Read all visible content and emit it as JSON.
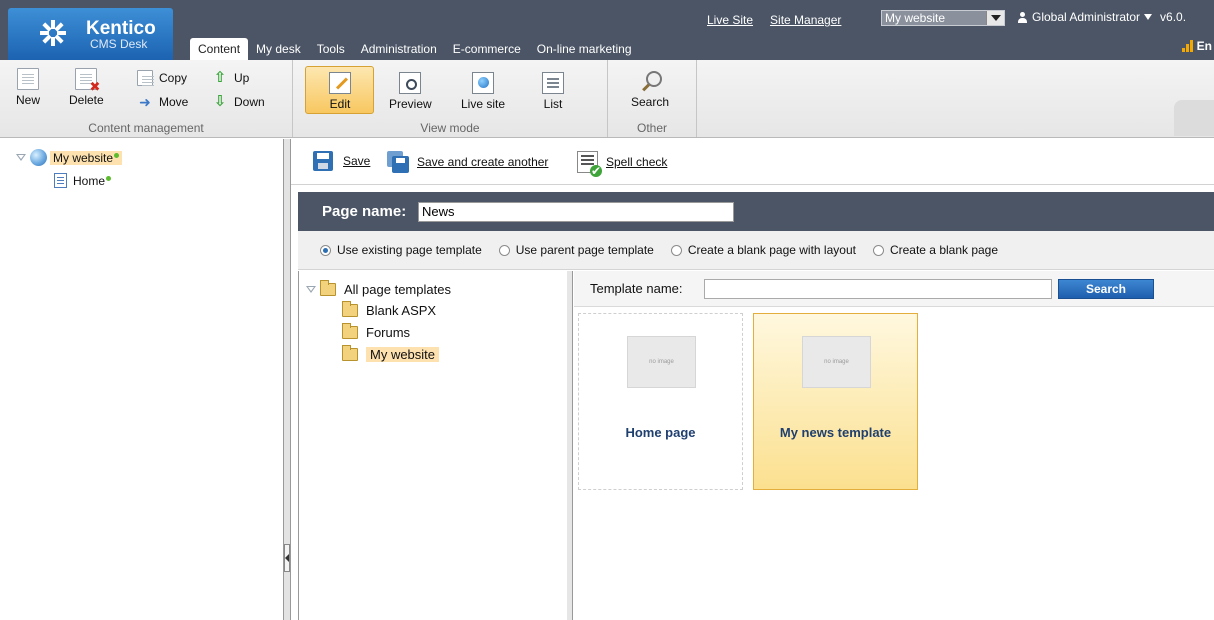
{
  "brand": {
    "name": "Kentico",
    "product": "CMS Desk",
    "accent": "#1c63b2"
  },
  "header": {
    "links": [
      "Live Site",
      "Site Manager"
    ],
    "site_select": "My website",
    "user": "Global Administrator",
    "version": "v6.0.",
    "lang": "En",
    "tabs": [
      "Content",
      "My desk",
      "Tools",
      "Administration",
      "E-commerce",
      "On-line marketing"
    ],
    "active_tab": "Content"
  },
  "ribbon": {
    "content_management": {
      "label": "Content management",
      "new": "New",
      "delete": "Delete",
      "copy": "Copy",
      "move": "Move",
      "up": "Up",
      "down": "Down"
    },
    "view_mode": {
      "label": "View mode",
      "edit": "Edit",
      "preview": "Preview",
      "live_site": "Live site",
      "list": "List"
    },
    "other": {
      "label": "Other",
      "search": "Search"
    }
  },
  "tree": {
    "root": "My website",
    "children": [
      "Home"
    ]
  },
  "toolbar": {
    "save": "Save",
    "save_and_create": "Save and create another",
    "spell_check": "Spell check"
  },
  "page_name": {
    "label": "Page name:",
    "value": "News"
  },
  "radio_options": [
    {
      "label": "Use existing page template",
      "checked": true
    },
    {
      "label": "Use parent page template",
      "checked": false
    },
    {
      "label": "Create a blank page with layout",
      "checked": false
    },
    {
      "label": "Create a blank page",
      "checked": false
    }
  ],
  "template_tree": {
    "root": "All page templates",
    "items": [
      "Blank ASPX",
      "Forums",
      "My website"
    ],
    "selected": "My website"
  },
  "template_search": {
    "label": "Template name:",
    "value": "",
    "button": "Search"
  },
  "templates": [
    {
      "name": "Home page",
      "image_text": "no image",
      "selected": false
    },
    {
      "name": "My news template",
      "image_text": "no image",
      "selected": true
    }
  ]
}
